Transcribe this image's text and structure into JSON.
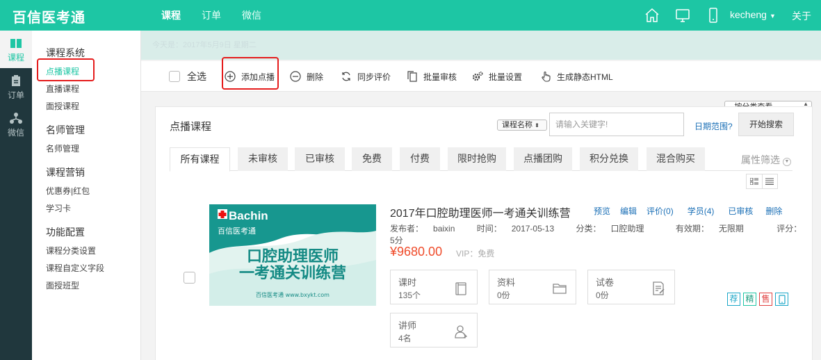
{
  "app": {
    "brand": "百信医考通"
  },
  "topnav": {
    "items": [
      "课程",
      "订单",
      "微信"
    ],
    "active": "课程"
  },
  "topicons": [
    "home-icon",
    "monitor-icon",
    "mobile-icon"
  ],
  "user": {
    "name": "kecheng",
    "logout": "关于"
  },
  "rail": [
    {
      "label": "课程",
      "icon": "book-icon"
    },
    {
      "label": "订单",
      "icon": "clipboard-icon"
    },
    {
      "label": "微信",
      "icon": "network-icon"
    }
  ],
  "sidebar": {
    "groups": [
      {
        "title": "课程系统",
        "items": [
          "点播课程",
          "直播课程",
          "面授课程"
        ]
      },
      {
        "title": "名师管理",
        "items": [
          "名师管理"
        ]
      },
      {
        "title": "课程营销",
        "items": [
          "优惠券|红包",
          "学习卡"
        ]
      },
      {
        "title": "功能配置",
        "items": [
          "课程分类设置",
          "课程自定义字段",
          "面授班型"
        ]
      }
    ]
  },
  "datestrip": "今天是：2017年5月9日 星期二",
  "toolbar": {
    "select_all": "全选",
    "add": "添加点播",
    "delete": "删除",
    "sync": "同步评价",
    "batch_review": "批量审核",
    "batch_settings": "批量设置",
    "generate_html": "生成静态HTML",
    "category_select": "--按分类查看--"
  },
  "card": {
    "title": "点播课程",
    "search_type": "课程名称",
    "search_placeholder": "请输入关键字!",
    "date_range": "日期范围?",
    "search_button": "开始搜索",
    "tabs": [
      "所有课程",
      "未审核",
      "已审核",
      "免费",
      "付费",
      "限时抢购",
      "点播团购",
      "积分兑换",
      "混合购买"
    ],
    "attr_filter": "属性筛选"
  },
  "course": {
    "title": "2017年口腔助理医师一考通关训练营",
    "actions": [
      "预览",
      "编辑",
      "评价(0)",
      "学员(4)",
      "已审核",
      "删除"
    ],
    "publisher_label": "发布者：",
    "publisher": "baixin",
    "time_label": "时间：",
    "time": "2017-05-13",
    "category_label": "分类：",
    "category": "口腔助理",
    "validity_label": "有效期：",
    "validity": "无限期",
    "score_label": "评分：",
    "score": "5分",
    "price": "¥9680.00",
    "vip": "VIP：免费",
    "thumb": {
      "logo": "Bachin",
      "logo_cn": "百信医考通",
      "line1": "口腔助理医师",
      "line2": "一考通关训练营",
      "footer": "百信医考通 www.bxykt.com"
    },
    "stats": [
      {
        "label": "课时",
        "value": "135个",
        "icon": "book-icon"
      },
      {
        "label": "资料",
        "value": "0份",
        "icon": "folder-icon"
      },
      {
        "label": "试卷",
        "value": "0份",
        "icon": "exam-icon"
      },
      {
        "label": "讲师",
        "value": "4名",
        "icon": "teacher-icon"
      }
    ],
    "badges": [
      "荐",
      "精",
      "售",
      "mobile"
    ]
  }
}
